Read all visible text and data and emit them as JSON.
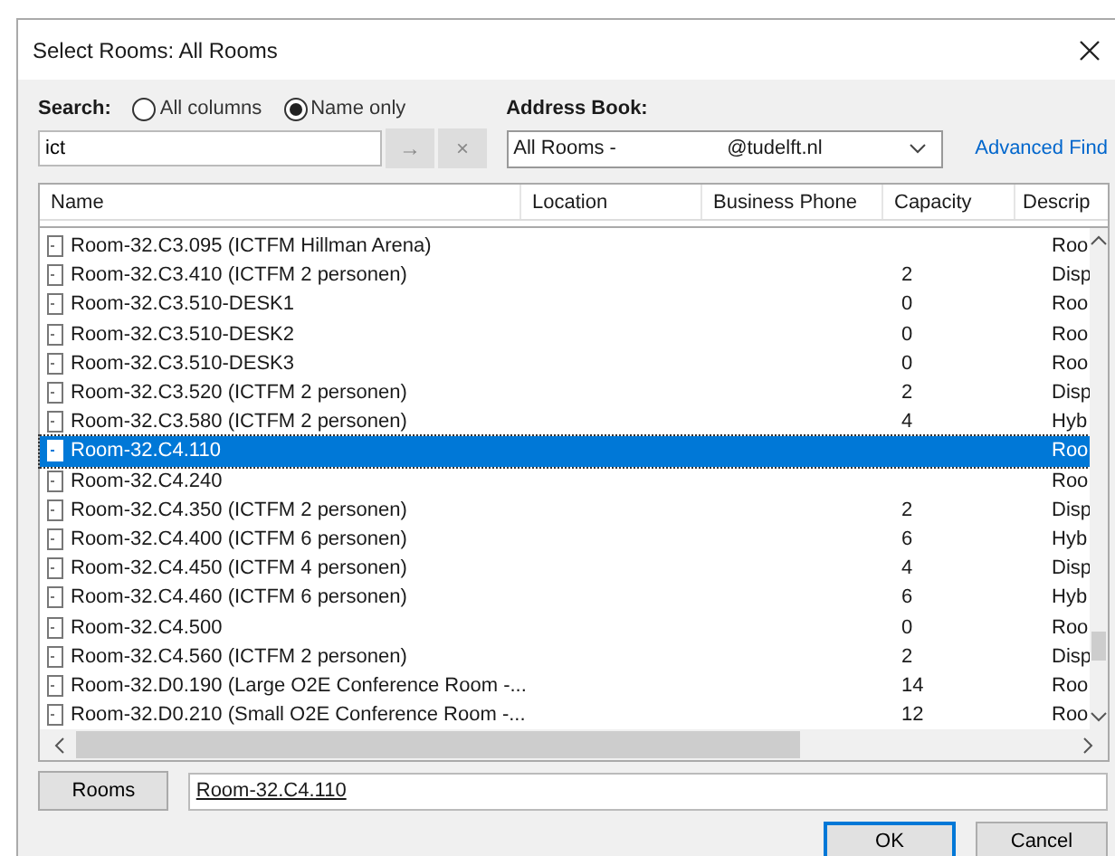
{
  "window": {
    "title": "Select Rooms: All Rooms"
  },
  "search": {
    "label": "Search:",
    "options": [
      {
        "label": "All columns",
        "selected": false
      },
      {
        "label": "Name only",
        "selected": true
      }
    ],
    "value": "ict",
    "go": "→",
    "clear": "×"
  },
  "address_book": {
    "label": "Address Book:",
    "value": "All Rooms -                    @tudelft.nl",
    "advanced_find": "Advanced Find"
  },
  "table": {
    "columns": [
      "Name",
      "Location",
      "Business Phone",
      "Capacity",
      "Descrip"
    ],
    "rows": [
      {
        "name": "Room-32.C3.095 (ICTFM Hillman Arena)",
        "capacity": "",
        "description": "Roo",
        "selected": false
      },
      {
        "name": "Room-32.C3.410 (ICTFM 2 personen)",
        "capacity": "2",
        "description": "Disp",
        "selected": false
      },
      {
        "name": "Room-32.C3.510-DESK1",
        "capacity": "0",
        "description": "Roo",
        "selected": false
      },
      {
        "name": "Room-32.C3.510-DESK2",
        "capacity": "0",
        "description": "Roo",
        "selected": false
      },
      {
        "name": "Room-32.C3.510-DESK3",
        "capacity": "0",
        "description": "Roo",
        "selected": false
      },
      {
        "name": "Room-32.C3.520 (ICTFM 2 personen)",
        "capacity": "2",
        "description": "Disp",
        "selected": false
      },
      {
        "name": "Room-32.C3.580 (ICTFM 2 personen)",
        "capacity": "4",
        "description": "Hyb",
        "selected": false
      },
      {
        "name": "Room-32.C4.110",
        "capacity": "",
        "description": "Roo",
        "selected": true
      },
      {
        "name": "Room-32.C4.240",
        "capacity": "",
        "description": "Roo",
        "selected": false
      },
      {
        "name": "Room-32.C4.350 (ICTFM 2 personen)",
        "capacity": "2",
        "description": "Disp",
        "selected": false
      },
      {
        "name": "Room-32.C4.400 (ICTFM 6 personen)",
        "capacity": "6",
        "description": "Hyb",
        "selected": false
      },
      {
        "name": "Room-32.C4.450 (ICTFM 4 personen)",
        "capacity": "4",
        "description": "Disp",
        "selected": false
      },
      {
        "name": "Room-32.C4.460 (ICTFM 6 personen)",
        "capacity": "6",
        "description": "Hyb",
        "selected": false
      },
      {
        "name": "Room-32.C4.500",
        "capacity": "0",
        "description": "Roo",
        "selected": false
      },
      {
        "name": "Room-32.C4.560 (ICTFM 2 personen)",
        "capacity": "2",
        "description": "Disp",
        "selected": false
      },
      {
        "name": "Room-32.D0.190 (Large O2E Conference Room -...",
        "capacity": "14",
        "description": "Roo",
        "selected": false
      },
      {
        "name": "Room-32.D0.210 (Small O2E Conference Room -...",
        "capacity": "12",
        "description": "Roo",
        "selected": false
      }
    ]
  },
  "rooms": {
    "button": "Rooms",
    "value": "Room-32.C4.110"
  },
  "buttons": [
    {
      "label": "OK",
      "kind": "default"
    },
    {
      "label": "Cancel",
      "kind": "normal"
    }
  ]
}
